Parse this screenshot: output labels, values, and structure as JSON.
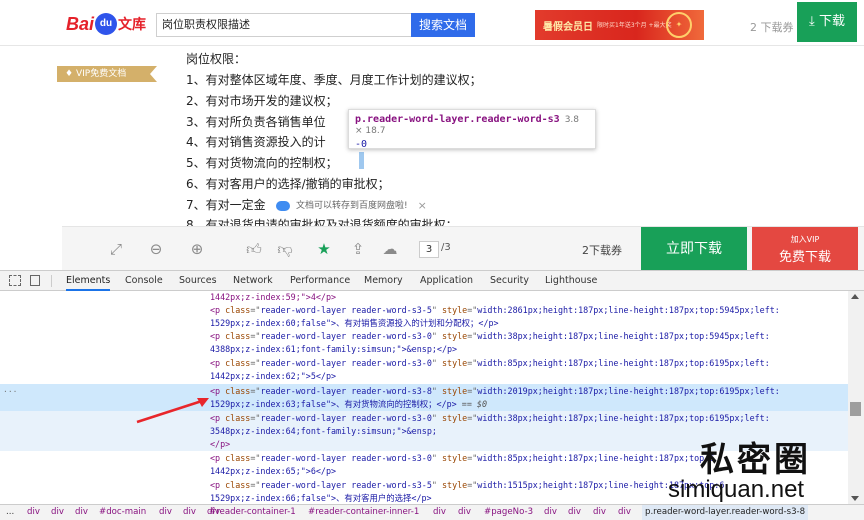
{
  "header": {
    "logo_text_1": "Bai",
    "logo_text_2": "du",
    "logo_text_3": "文库",
    "search_value": "岗位职责权限描述",
    "search_button": "搜索文档",
    "ad_title": "暑假会员日",
    "ad_sub": "限时买1年送3个月 +最大奖",
    "download_count": "2 下载券",
    "download_button": "下载"
  },
  "document": {
    "vip_badge": "VIP免费文档",
    "lines": [
      "岗位权限：",
      "1、有对整体区域年度、季度、月度工作计划的建议权；",
      "2、有对市场开发的建议权；",
      "3、有对所负责各销售单位",
      "4、有对销售资源投入的计",
      "5、有对货物流向的控制权；",
      "6、有对客用户的选择/撤销的审批权；",
      "7、有对一定金",
      "8、有对退货申请的审批权及对退货额度的审批权；"
    ],
    "tooltip_selector": "p.reader-word-layer.reader-word-s3",
    "tooltip_size": "3.8 × 18.7",
    "tooltip_value": "-0",
    "pan_tip": "文档可以转存到百度网盘啦!",
    "pan_close": "×"
  },
  "reader_bar": {
    "page_current": "3",
    "page_total": "/3",
    "download_count": "2下载券",
    "download_now": "立即下载",
    "vip_line1": "加入VIP",
    "vip_line2": "免费下载"
  },
  "devtools": {
    "tabs": [
      "Elements",
      "Console",
      "Sources",
      "Network",
      "Performance",
      "Memory",
      "Application",
      "Security",
      "Lighthouse"
    ],
    "active_tab": "Elements",
    "rows": [
      {
        "pre": "1442px;z-index:59;\">4</p>"
      },
      {
        "cls": "reader-word-layer reader-word-s3-5",
        "style": "width:2861px;height:187px;line-height:187px;top:5945px;left:",
        "cont": "1529px;z-index:60;false\">、有对销售资源投入的计划和分配权；</p>"
      },
      {
        "cls": "reader-word-layer reader-word-s3-0",
        "style": "width:38px;height:187px;line-height:187px;top:5945px;left:",
        "cont": "4388px;z-index:61;font-family:simsun;\">&ensp;</p>"
      },
      {
        "cls": "reader-word-layer reader-word-s3-0",
        "style": "width:85px;height:187px;line-height:187px;top:6195px;left:",
        "cont": "1442px;z-index:62;\">5</p>"
      },
      {
        "cls": "reader-word-layer reader-word-s3-8",
        "style": "width:2019px;height:187px;line-height:187px;top:6195px;left:",
        "cont": "1529px;z-index:63;false\">、有对货物流向的控制权；</p>",
        "suffix": "== $0"
      },
      {
        "cls": "reader-word-layer reader-word-s3-0",
        "style": "width:38px;height:187px;line-height:187px;top:6195px;left:",
        "cont": "3548px;z-index:64;font-family:simsun;\">&ensp;",
        "close": "</p>"
      },
      {
        "cls": "reader-word-layer reader-word-s3-0",
        "style": "width:85px;height:187px;line-height:187px;top:6",
        "cont": "1442px;z-index:65;\">6</p>"
      },
      {
        "cls": "reader-word-layer reader-word-s3-5",
        "style": "width:1515px;height:187px;line-height:187px;top:6",
        "cont": "1529px;z-index:66;false\">、有对客用户的选择</p>"
      }
    ],
    "ellipsis": "...",
    "breadcrumbs": [
      "...",
      "div",
      "div",
      "div",
      "#doc-main",
      "div",
      "div",
      "div",
      "#reader-container-1",
      "#reader-container-inner-1",
      "div",
      "div",
      "#pageNo-3",
      "div",
      "div",
      "div",
      "div",
      "p.reader-word-layer.reader-word-s3-8"
    ]
  },
  "watermark": {
    "cn": "私密圈",
    "en": "simiquan.net"
  },
  "colors": {
    "green": "#18a058",
    "red": "#e44841",
    "blue": "#2f6bea",
    "tag": "#881280",
    "attr_name": "#994500",
    "attr_value": "#1a1aa6"
  }
}
